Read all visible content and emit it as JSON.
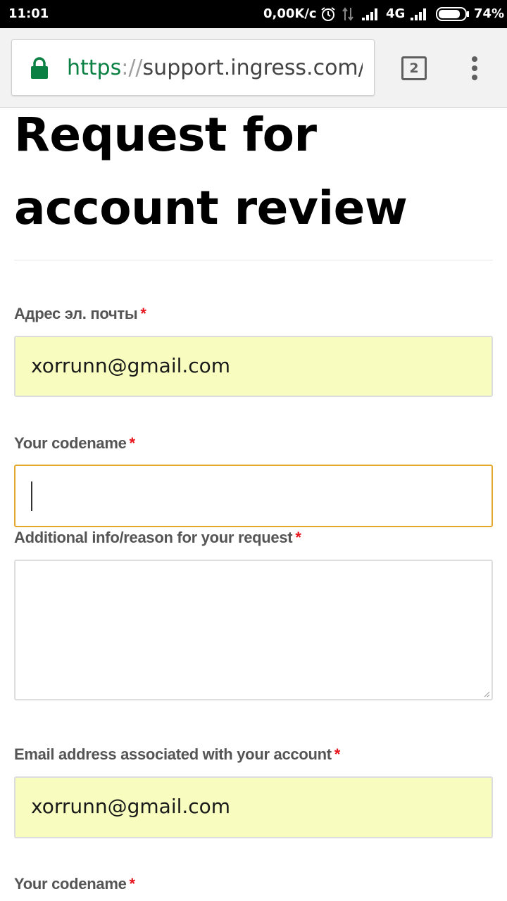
{
  "status_bar": {
    "time": "11:01",
    "net_speed": "0,00K/c",
    "network_type": "4G",
    "battery": "74%"
  },
  "browser": {
    "url_scheme": "https",
    "url_separator": "://",
    "url_host": "support.ingress.com/hc",
    "tab_count": "2",
    "secure_color": "#0b8043"
  },
  "page": {
    "title": "Request for account review"
  },
  "form": {
    "required_marker": "*",
    "fields": [
      {
        "label": "Адрес эл. почты",
        "value": "xorrunn@gmail.com",
        "autofilled": true
      },
      {
        "label": "Your codename",
        "value": "",
        "focused": true
      },
      {
        "label": "Additional info/reason for your request",
        "value": ""
      },
      {
        "label": "Email address associated with your account",
        "value": "xorrunn@gmail.com",
        "autofilled": true
      },
      {
        "label": "Your codename",
        "value": ""
      }
    ]
  },
  "colors": {
    "autofill_background": "#f8fdbf",
    "focus_border": "#e3a72b",
    "required": "#e8141c"
  }
}
